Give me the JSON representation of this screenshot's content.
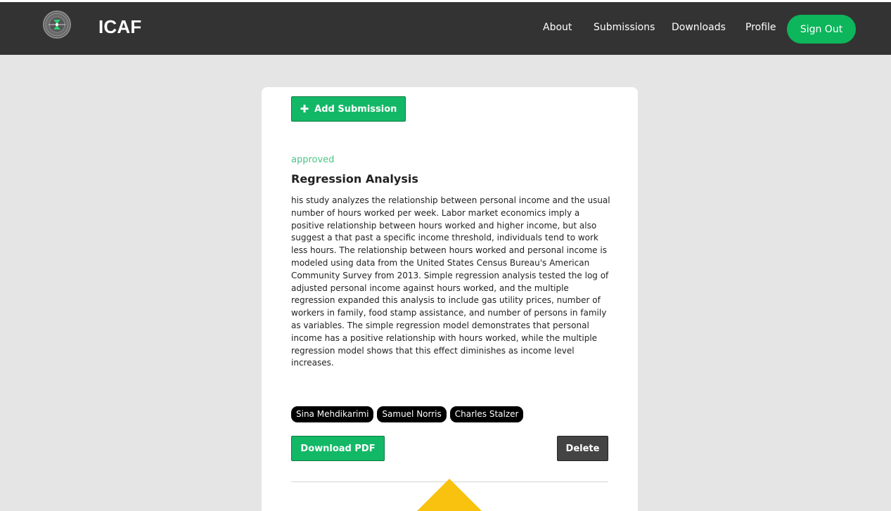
{
  "header": {
    "brand": "ICAF",
    "nav": [
      "About",
      "Submissions",
      "Downloads",
      "Profile"
    ],
    "sign_out": "Sign Out",
    "logo_icon": "icaf-logo-icon"
  },
  "main": {
    "add_submission_label": "Add Submission",
    "add_icon": "plus-icon",
    "submission": {
      "status": "approved",
      "title": "Regression Analysis",
      "abstract": "his study analyzes the relationship between personal income and the usual number of hours worked per week. Labor market economics imply a positive relationship between hours worked and higher income, but also suggest a that past a specific income threshold, individuals tend to work less hours. The relationship between hours worked and personal income is modeled using data from the United States Census Bureau's American Community Survey from 2013. Simple regression analysis tested the log of adjusted personal income against hours worked, and the multiple regression expanded this analysis to include gas utility prices, number of workers in family, food stamp assistance, and number of persons in family as variables. The simple regression model demonstrates that personal income has a positive relationship with hours worked, while the multiple regression model shows that this effect diminishes as income level increases.",
      "authors": [
        "Sina Mehdikarimi",
        "Samuel Norris",
        "Charles Stalzer"
      ],
      "download_label": "Download PDF",
      "delete_label": "Delete"
    }
  },
  "colors": {
    "navbar": "#333333",
    "accent_green": "#13b866",
    "status_green": "#4cc586",
    "delete_dark": "#444444",
    "scroll_top_yellow": "#f9c20f"
  }
}
